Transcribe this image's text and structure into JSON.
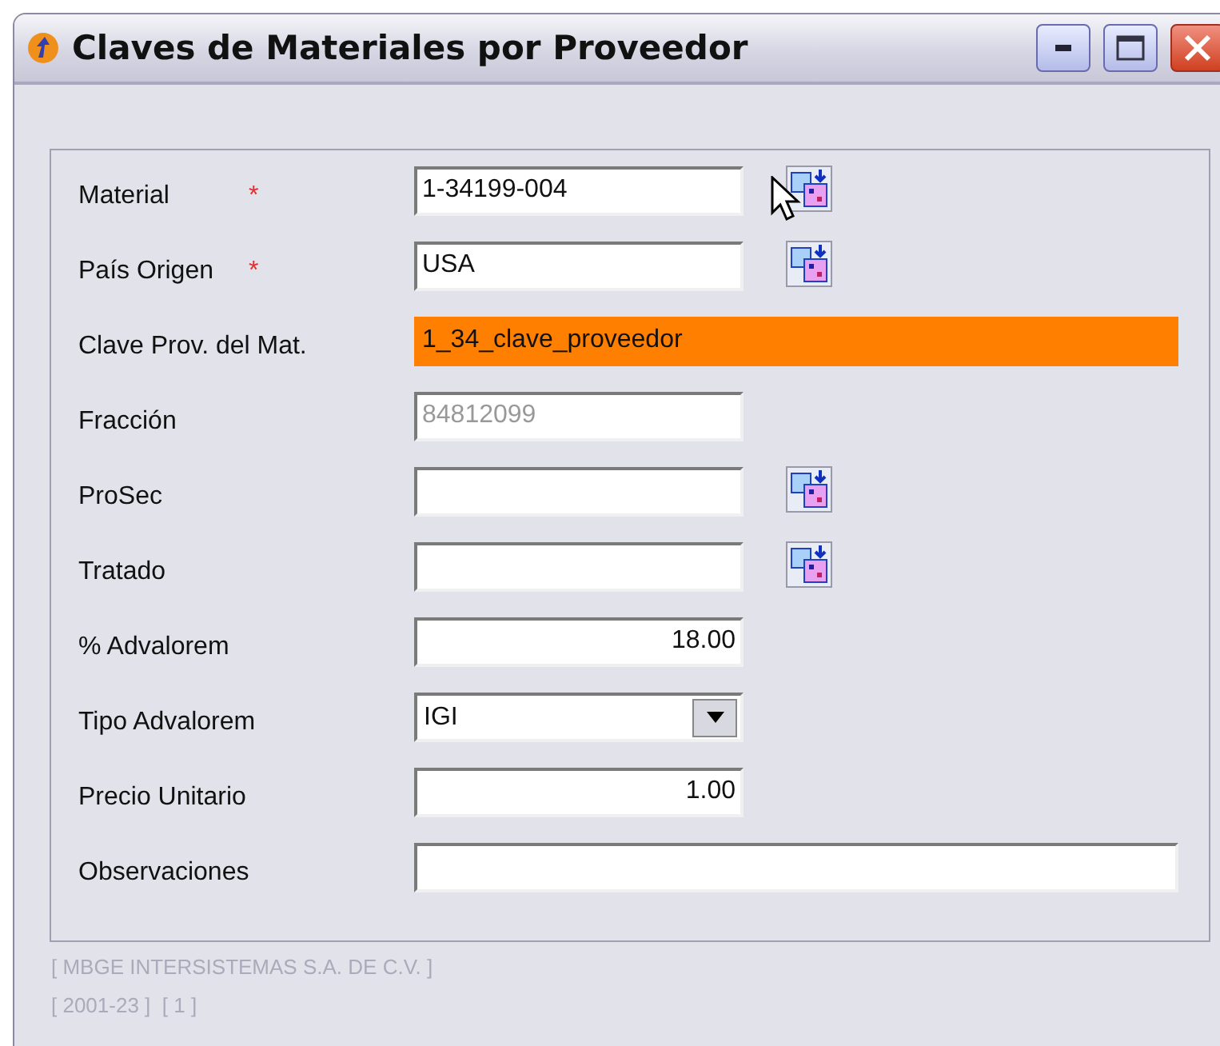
{
  "window": {
    "title": "Claves de Materiales por Proveedor"
  },
  "fields": [
    {
      "label": "Material",
      "mark": "*",
      "kind": "text",
      "value": "1-34199-004",
      "lookup": true,
      "right_aligned": false,
      "wide": false
    },
    {
      "label": "País Origen",
      "mark": "*",
      "kind": "text",
      "value": "USA",
      "lookup": true,
      "right_aligned": false,
      "wide": false
    },
    {
      "label": "Clave Prov. del Mat.",
      "kind": "highlighted",
      "value": "1_34_clave_proveedor",
      "lookup": false,
      "right_aligned": false,
      "wide": true
    },
    {
      "label": "Fracción",
      "kind": "disabled",
      "value": "84812099",
      "lookup": false,
      "right_aligned": false,
      "wide": false
    },
    {
      "label": "ProSec",
      "kind": "text",
      "lookup": true,
      "right_aligned": false,
      "wide": false
    },
    {
      "label": "Tratado",
      "kind": "text",
      "lookup": true,
      "right_aligned": false,
      "wide": false
    },
    {
      "label": "% Advalorem",
      "kind": "text",
      "value": "18.00",
      "lookup": false,
      "right_aligned": true,
      "wide": false
    },
    {
      "label": "Tipo Advalorem",
      "kind": "dropdown",
      "value": "IGI",
      "lookup": false,
      "wide": false
    },
    {
      "label": "Precio Unitario",
      "kind": "text",
      "value": "1.00",
      "lookup": false,
      "right_aligned": true,
      "wide": false
    },
    {
      "label": "Observaciones",
      "kind": "text",
      "lookup": false,
      "right_aligned": false,
      "wide": true
    }
  ],
  "footer": [
    "[ MBGE INTERSISTEMAS S.A. DE C.V. ]",
    "[ 2001-23 ]  [ 1 ]"
  ]
}
